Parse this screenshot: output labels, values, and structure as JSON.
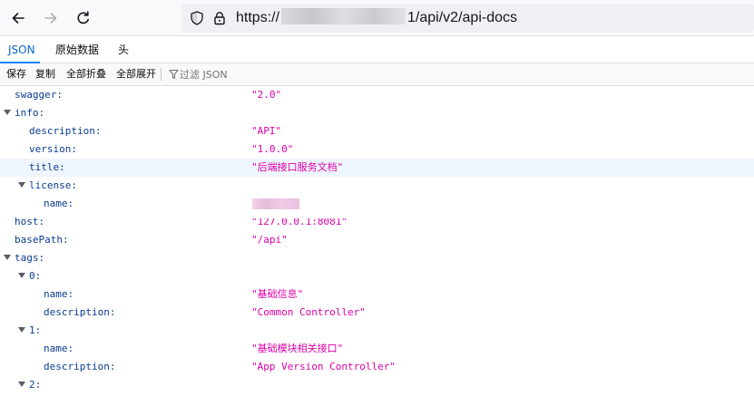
{
  "browser": {
    "url_start": "https://",
    "url_end": "1/api/v2/api-docs",
    "icons": {
      "back": "arrow-left-icon",
      "forward": "arrow-right-icon",
      "reload": "reload-icon",
      "shield": "shield-icon",
      "lock": "lock-icon"
    }
  },
  "viewer": {
    "tabs": [
      {
        "label": "JSON",
        "active": true
      },
      {
        "label": "原始数据",
        "active": false
      },
      {
        "label": "头",
        "active": false
      }
    ],
    "toolbar": {
      "save": "保存",
      "copy": "复制",
      "collapse_all": "全部折叠",
      "expand_all": "全部展开",
      "filter_placeholder": "过滤 JSON"
    }
  },
  "tree": [
    {
      "key": "swagger:",
      "value": "\"2.0\""
    },
    {
      "key": "info:",
      "expanded": true
    },
    {
      "key": "description:",
      "value": "\"API\""
    },
    {
      "key": "version:",
      "value": "\"1.0.0\""
    },
    {
      "key": "title:",
      "value": "\"后端接口服务文档\"",
      "selected": true
    },
    {
      "key": "license:",
      "expanded": true
    },
    {
      "key": "name:",
      "value_redacted": true
    },
    {
      "key": "host:",
      "value": "\"127.0.0.1:8081\""
    },
    {
      "key": "basePath:",
      "value": "\"/api\""
    },
    {
      "key": "tags:",
      "expanded": true
    },
    {
      "key": "0:",
      "expanded": true
    },
    {
      "key": "name:",
      "value": "\"基础信息\""
    },
    {
      "key": "description:",
      "value": "\"Common Controller\""
    },
    {
      "key": "1:",
      "expanded": true
    },
    {
      "key": "name:",
      "value": "\"基础模块相关接口\""
    },
    {
      "key": "description:",
      "value": "\"App Version Controller\""
    },
    {
      "key": "2:",
      "expanded": true
    }
  ],
  "colors": {
    "key": "#0a3d91",
    "string_value": "#dd00a9",
    "active_tab": "#0a63c7",
    "selected_row": "#eef5fd"
  }
}
